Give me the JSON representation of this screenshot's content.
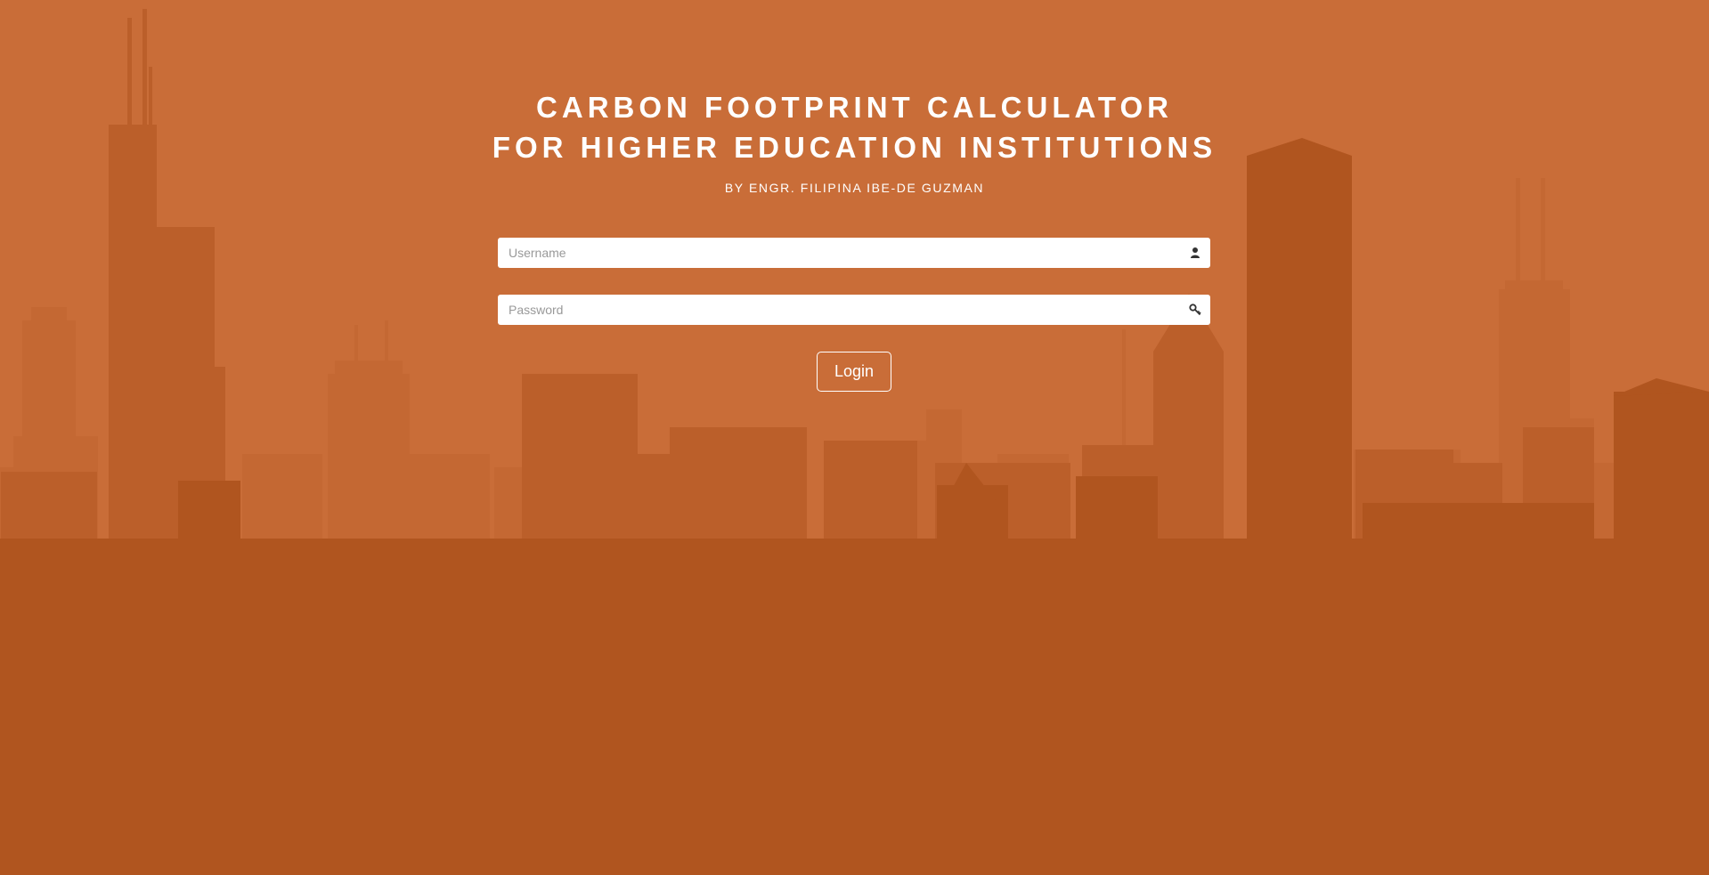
{
  "header": {
    "title_line1": "CARBON FOOTPRINT CALCULATOR",
    "title_line2": "FOR HIGHER EDUCATION INSTITUTIONS",
    "byline": "BY ENGR. FILIPINA IBE-DE GUZMAN"
  },
  "form": {
    "username": {
      "placeholder": "Username",
      "value": "",
      "icon": "user-icon"
    },
    "password": {
      "placeholder": "Password",
      "value": "",
      "icon": "key-icon"
    },
    "login_label": "Login"
  },
  "colors": {
    "background": "#c96d38",
    "skyline_far": "#c26733",
    "skyline_mid": "#b85c28",
    "skyline_near": "#b0551f",
    "text": "#ffffff"
  }
}
